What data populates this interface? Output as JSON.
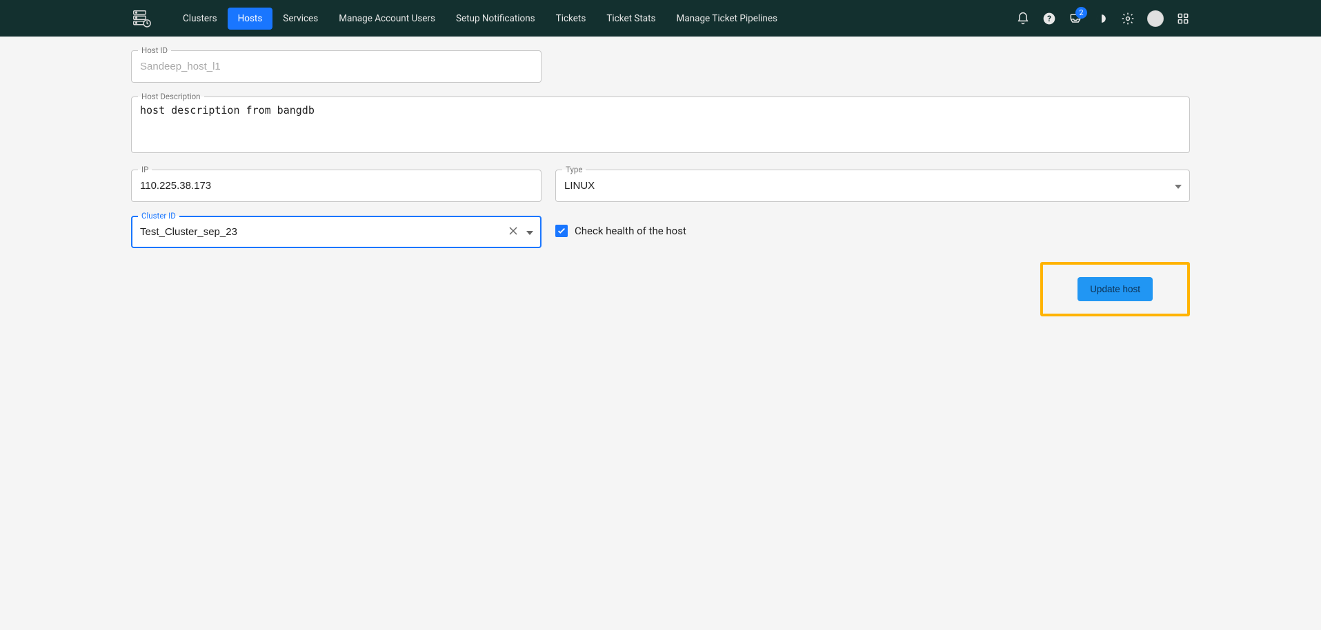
{
  "nav": {
    "items": [
      {
        "label": "Clusters",
        "active": false
      },
      {
        "label": "Hosts",
        "active": true
      },
      {
        "label": "Services",
        "active": false
      },
      {
        "label": "Manage Account Users",
        "active": false
      },
      {
        "label": "Setup Notifications",
        "active": false
      },
      {
        "label": "Tickets",
        "active": false
      },
      {
        "label": "Ticket Stats",
        "active": false
      },
      {
        "label": "Manage Ticket Pipelines",
        "active": false
      }
    ],
    "badge_count": "2"
  },
  "form": {
    "host_id": {
      "label": "Host ID",
      "value": "Sandeep_host_l1"
    },
    "host_description": {
      "label": "Host Description",
      "value": "host description from bangdb"
    },
    "ip": {
      "label": "IP",
      "value": "110.225.38.173"
    },
    "type": {
      "label": "Type",
      "value": "LINUX"
    },
    "cluster_id": {
      "label": "Cluster ID",
      "value": "Test_Cluster_sep_23"
    },
    "check_health": {
      "label": "Check health of the host",
      "checked": true
    },
    "update_button": "Update host"
  }
}
